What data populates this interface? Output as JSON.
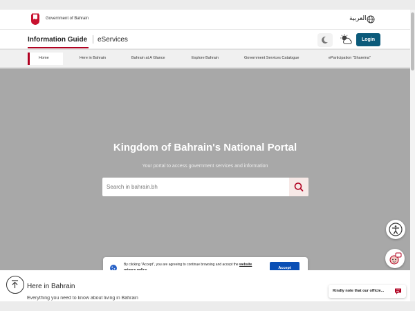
{
  "header": {
    "gov_name": "Government of Bahrain",
    "lang_switch": "العربية"
  },
  "nav": {
    "tabs": [
      {
        "label": "Information Guide",
        "active": true
      },
      {
        "label": "eServices",
        "active": false
      }
    ],
    "login_label": "Login"
  },
  "menu": {
    "items": [
      "Home",
      "Here in Bahrain",
      "Bahrain at A Glance",
      "Explore Bahrain",
      "Government Services Catalogue",
      "eParticipation \"Shareina\""
    ]
  },
  "hero": {
    "title": "Kingdom of Bahrain's National Portal",
    "subtitle": "Your portal to access government services and information",
    "search_placeholder": "Search in bahrain.bh"
  },
  "cookie": {
    "text": "By clicking \"Accept\", you are agreeing to continue browsing and accept the",
    "link": "website privacy policy.",
    "accept_label": "Accept"
  },
  "section": {
    "title": "Here in Bahrain",
    "description": "Everything you need to know about living in Bahrain"
  },
  "notice": {
    "text": "Kindly note that our officie..."
  },
  "colors": {
    "accent_red": "#b00020",
    "login_blue": "#0b5a7a",
    "accept_blue": "#0a4fb5",
    "hero_gray": "#a8a8a8"
  }
}
